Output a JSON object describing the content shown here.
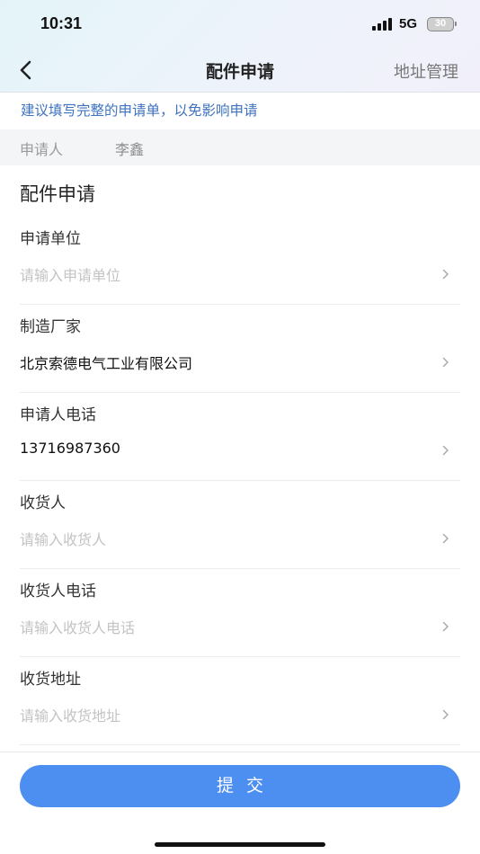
{
  "status_bar": {
    "time": "10:31",
    "network": "5G",
    "battery": "30"
  },
  "nav": {
    "back_icon": "chevron-left-icon",
    "title": "配件申请",
    "right_action": "地址管理"
  },
  "notice": "建议填写完整的申请单，以免影响申请",
  "applicant": {
    "label": "申请人",
    "value": "李鑫"
  },
  "section_title": "配件申请",
  "fields": [
    {
      "label": "申请单位",
      "value": "",
      "placeholder": "请输入申请单位"
    },
    {
      "label": "制造厂家",
      "value": "北京索德电气工业有限公司",
      "placeholder": ""
    },
    {
      "label": "申请人电话",
      "value": "13716987360",
      "placeholder": ""
    },
    {
      "label": "收货人",
      "value": "",
      "placeholder": "请输入收货人"
    },
    {
      "label": "收货人电话",
      "value": "",
      "placeholder": "请输入收货人电话"
    },
    {
      "label": "收货地址",
      "value": "",
      "placeholder": "请输入收货地址"
    }
  ],
  "submit_label": "提交",
  "colors": {
    "accent": "#4d8ff0",
    "notice_text": "#3f73c0",
    "placeholder": "#c3c3c3"
  }
}
